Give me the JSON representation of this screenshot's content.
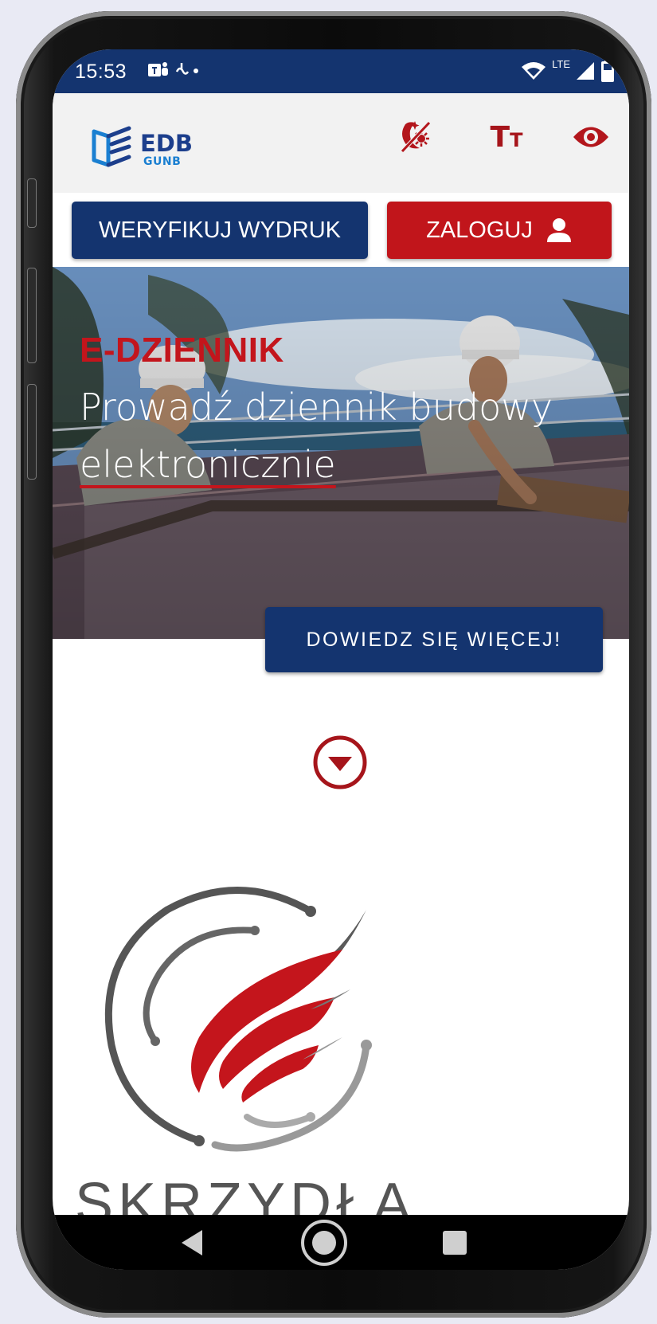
{
  "status_bar": {
    "time": "15:53",
    "app_icons": "teams-icon, notification-icon",
    "network": "LTE"
  },
  "header": {
    "logo_title": "EDB",
    "logo_subtitle": "GUNB",
    "icons": [
      "contrast-icon",
      "text-size-icon",
      "visibility-icon"
    ],
    "text_size_glyph": "Tт"
  },
  "actions": {
    "verify_label": "WERYFIKUJ WYDRUK",
    "login_label": "ZALOGUJ"
  },
  "hero": {
    "kicker": "E-DZIENNIK",
    "title_line1": "Prowadź dziennik budowy",
    "title_line2": "elektronicznie",
    "cta_label": "DOWIEDZ SIĘ WIĘCEJ!"
  },
  "section": {
    "brand_name": "SKRZYDŁA"
  },
  "colors": {
    "navy": "#14346f",
    "red": "#c1151b",
    "header_bg": "#f2f2f2"
  }
}
